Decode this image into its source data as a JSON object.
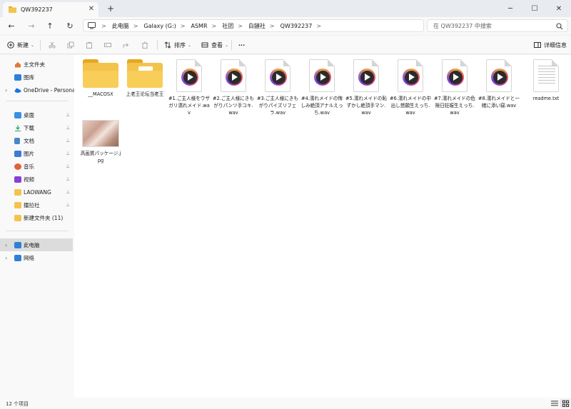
{
  "window": {
    "tab_title": "QW392237",
    "tab_close": "✕",
    "new_tab": "+",
    "minimize": "─",
    "maximize": "☐",
    "close": "✕"
  },
  "nav": {
    "back": "←",
    "forward": "→",
    "up": "↑",
    "refresh": "↻"
  },
  "breadcrumb": {
    "items": [
      "此电脑",
      "Galaxy (G:)",
      "ASMR",
      "社团",
      "白鏈社",
      "QW392237"
    ],
    "separator": ">"
  },
  "search": {
    "placeholder": "在 QW392237 中搜索"
  },
  "toolbar": {
    "new_label": "新建",
    "sort_label": "排序",
    "view_label": "查看",
    "more_label": "···",
    "details_label": "详细信息"
  },
  "sidebar": {
    "items": [
      {
        "label": "主文件夹",
        "icon": "home-icon",
        "color": "#e07a3c"
      },
      {
        "label": "图库",
        "icon": "gallery-icon",
        "color": "#2f7fd8"
      },
      {
        "label": "OneDrive - Personal",
        "icon": "cloud-icon",
        "color": "#1a73e8"
      },
      {
        "label": "桌面",
        "icon": "desktop-icon",
        "color": "#3a8ee6"
      },
      {
        "label": "下载",
        "icon": "download-icon",
        "color": "#2aa876"
      },
      {
        "label": "文档",
        "icon": "document-icon",
        "color": "#4a86c8"
      },
      {
        "label": "图片",
        "icon": "pictures-icon",
        "color": "#3b7bd4"
      },
      {
        "label": "音乐",
        "icon": "music-icon",
        "color": "#e0603a"
      },
      {
        "label": "视频",
        "icon": "video-icon",
        "color": "#8a3fd1"
      },
      {
        "label": "LAOWANG",
        "icon": "folder-icon",
        "color": "#f3c34b"
      },
      {
        "label": "擂拉社",
        "icon": "folder-icon",
        "color": "#f3c34b"
      },
      {
        "label": "新建文件夹 (11)",
        "icon": "folder-icon",
        "color": "#f3c34b"
      },
      {
        "label": "此电脑",
        "icon": "computer-icon",
        "color": "#2f7fd8"
      },
      {
        "label": "网络",
        "icon": "network-icon",
        "color": "#2f7fd8"
      }
    ]
  },
  "files": [
    {
      "name": "__MACOSX",
      "type": "folder"
    },
    {
      "name": "上老王论坛当老王",
      "type": "folder"
    },
    {
      "name": "#1.ご主人様をウザガリ濡れメイド.wav",
      "type": "audio"
    },
    {
      "name": "#2.ご主人様にきもがりパンツ手コキ.wav",
      "type": "audio"
    },
    {
      "name": "#3.ご主人様にきもがりパイズリフェラ.wav",
      "type": "audio"
    },
    {
      "name": "#4.濡れメイドの悔しみ絶頂アナルえっち.wav",
      "type": "audio"
    },
    {
      "name": "#5.濡れメイドの恥ずかし絶頂手マン.wav",
      "type": "audio"
    },
    {
      "name": "#6.濡れメイドの中出し懇願生えっち.wav",
      "type": "audio"
    },
    {
      "name": "#7.濡れメイドの危険日妊娠生えっち.wav",
      "type": "audio"
    },
    {
      "name": "#8.濡れメイドと一緒に添い寝.wav",
      "type": "audio"
    },
    {
      "name": "readme.txt",
      "type": "text"
    },
    {
      "name": "高画質パッケージ.jpg",
      "type": "image"
    }
  ],
  "status": {
    "item_count": "12 个项目"
  },
  "icons": {
    "pin": "📌",
    "chevron": "›"
  }
}
